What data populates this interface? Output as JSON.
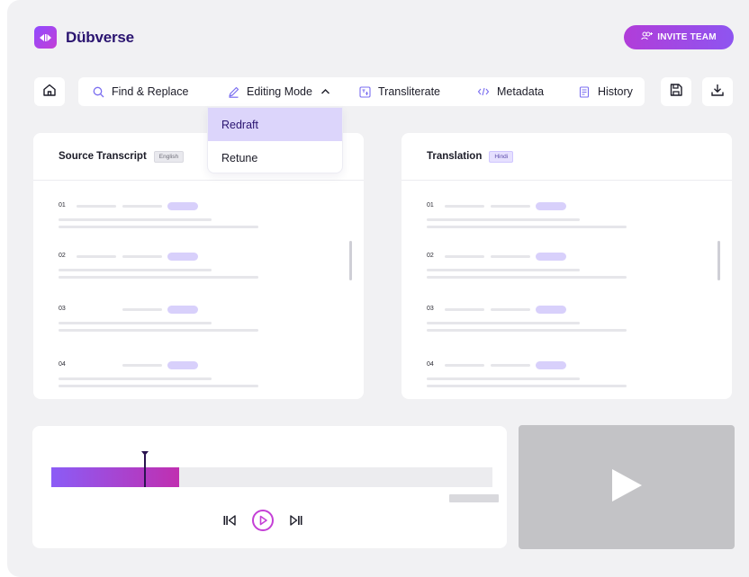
{
  "app": {
    "name": "Dübverse"
  },
  "header": {
    "invite_label": "INVITE TEAM"
  },
  "toolbar": {
    "items": [
      {
        "label": "Find & Replace",
        "icon": "search-icon"
      },
      {
        "label": "Editing Mode",
        "icon": "pen-icon"
      },
      {
        "label": "Transliterate",
        "icon": "transliterate-icon"
      },
      {
        "label": "Metadata",
        "icon": "code-icon"
      },
      {
        "label": "History",
        "icon": "history-icon"
      }
    ],
    "home_icon": "home-icon",
    "save_icon": "save-icon",
    "download_icon": "download-icon"
  },
  "editing_mode_menu": {
    "options": [
      "Redraft",
      "Retune"
    ],
    "selected": "Redraft"
  },
  "source_panel": {
    "title": "Source Transcript",
    "language": "English",
    "rows": [
      "01",
      "02",
      "03",
      "04"
    ]
  },
  "translation_panel": {
    "title": "Translation",
    "language": "Hindi",
    "rows": [
      "01",
      "02",
      "03",
      "04"
    ]
  },
  "player": {
    "progress_fraction": 0.29,
    "playhead_fraction": 0.21
  },
  "colors": {
    "brand": "#8f4bff",
    "accent_gradient_start": "#8b5cf6",
    "accent_gradient_end": "#c02fb0",
    "menu_selected": "#dcd5fb"
  }
}
